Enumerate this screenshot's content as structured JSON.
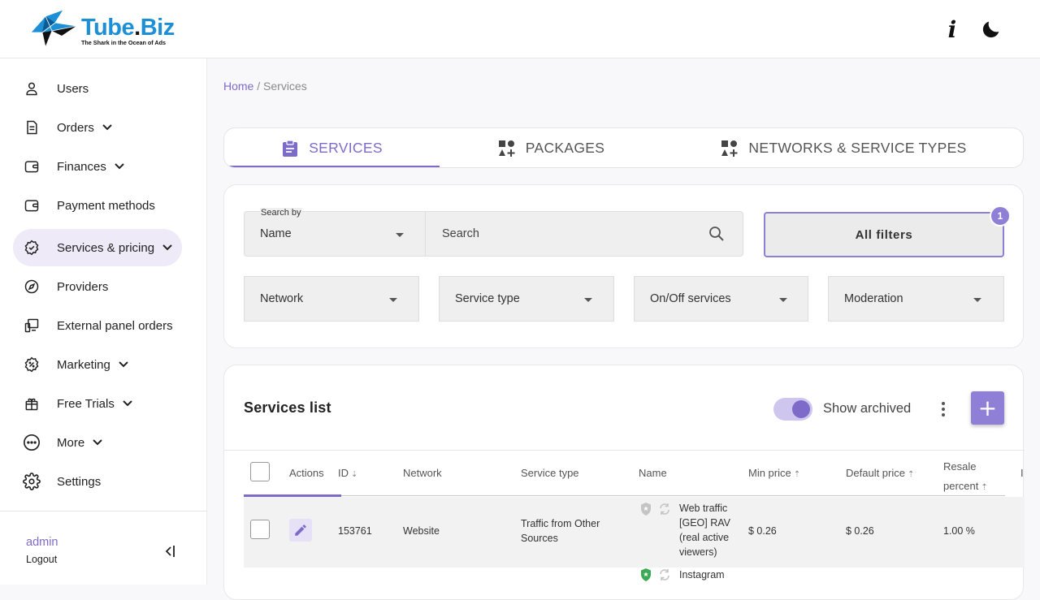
{
  "header": {
    "logo_word_a": "Tube",
    "logo_word_dot": ".",
    "logo_word_b": "Biz",
    "logo_tagline": "The Shark in the Ocean of Ads",
    "info_label": "i",
    "logo_color": "#1d8fd6",
    "accent": "#7e6bc9"
  },
  "sidebar": {
    "items": [
      {
        "label": "Users",
        "icon": "user-icon",
        "has_chevron": false
      },
      {
        "label": "Orders",
        "icon": "orders-icon",
        "has_chevron": true
      },
      {
        "label": "Finances",
        "icon": "wallet-icon",
        "has_chevron": true
      },
      {
        "label": "Payment methods",
        "icon": "wallet-icon",
        "has_chevron": false
      },
      {
        "label": "Services & pricing",
        "icon": "badge-check-icon",
        "has_chevron": true,
        "active": true
      },
      {
        "label": "Providers",
        "icon": "compass-icon",
        "has_chevron": false
      },
      {
        "label": "External panel orders",
        "icon": "devices-icon",
        "has_chevron": false
      },
      {
        "label": "Marketing",
        "icon": "discount-icon",
        "has_chevron": true
      },
      {
        "label": "Free Trials",
        "icon": "gift-icon",
        "has_chevron": true
      },
      {
        "label": "More",
        "icon": "more-icon",
        "has_chevron": true
      },
      {
        "label": "Settings",
        "icon": "gear-icon",
        "has_chevron": false
      }
    ],
    "user": "admin",
    "logout": "Logout"
  },
  "breadcrumb": {
    "home": "Home",
    "separator": " / ",
    "current": "Services"
  },
  "tabs": [
    {
      "label": "SERVICES",
      "active": true
    },
    {
      "label": "PACKAGES",
      "active": false
    },
    {
      "label": "NETWORKS & SERVICE TYPES",
      "active": false
    }
  ],
  "filters": {
    "search_by_label": "Search by",
    "search_by_value": "Name",
    "search_placeholder": "Search",
    "all_filters": "All filters",
    "all_filters_count": "1",
    "selects": [
      "Network",
      "Service type",
      "On/Off services",
      "Moderation"
    ]
  },
  "services_list": {
    "title": "Services list",
    "show_archived_label": "Show archived",
    "show_archived": true,
    "add_label": "+",
    "columns": {
      "actions": "Actions",
      "id": "ID",
      "network": "Network",
      "service_type": "Service type",
      "name": "Name",
      "min_price": "Min price",
      "default_price": "Default price",
      "resale_a": "Resale",
      "resale_b": "percent",
      "extra": "I"
    },
    "rows": [
      {
        "id": "153761",
        "network": "Website",
        "service_type_a": "Traffic from Other",
        "service_type_b": "Sources",
        "name_lines": [
          "Web traffic",
          "[GEO] RAV",
          "(real active",
          "viewers)"
        ],
        "min_price": "$ 0.26",
        "default_price": "$ 0.26",
        "resale_percent": "1.00 %"
      }
    ],
    "partial_row_name": "Instagram"
  }
}
